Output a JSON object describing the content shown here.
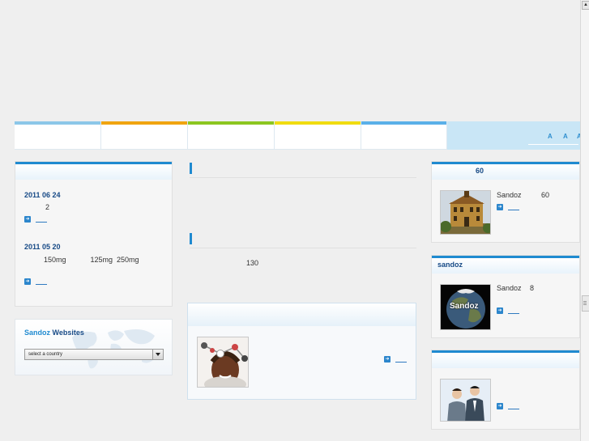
{
  "nav": {
    "tabs": [
      {
        "label": "",
        "color": "#8cc7e8"
      },
      {
        "label": "",
        "color": "#f0a410"
      },
      {
        "label": "",
        "color": "#8cc620"
      },
      {
        "label": "",
        "color": "#f0dc10"
      },
      {
        "label": "",
        "color": "#5ab0e8"
      }
    ],
    "font_size_controls": [
      "A",
      "A",
      "A"
    ]
  },
  "news_panel": {
    "items": [
      {
        "date": "2011 06 24",
        "text": "2"
      },
      {
        "date": "2011 05 20",
        "text": "150mg            125mg  250mg"
      }
    ]
  },
  "sandoz_websites": {
    "title_part1": "Sandoz",
    "title_part2": "Websites",
    "select_value": "select a country"
  },
  "middle": {
    "section1_title": "",
    "section2_title": "",
    "section2_text": "130",
    "feature_box_title": ""
  },
  "right": {
    "panel1": {
      "title": "60",
      "caption_left": "Sandoz",
      "caption_right": "60"
    },
    "panel2": {
      "title": "sandoz",
      "caption_left": "Sandoz",
      "caption_right": "8",
      "image_label": "Sandoz"
    },
    "panel3": {
      "title": ""
    }
  },
  "colors": {
    "accent": "#1f8ad0",
    "title": "#174a86",
    "link": "#2f7ac0"
  }
}
